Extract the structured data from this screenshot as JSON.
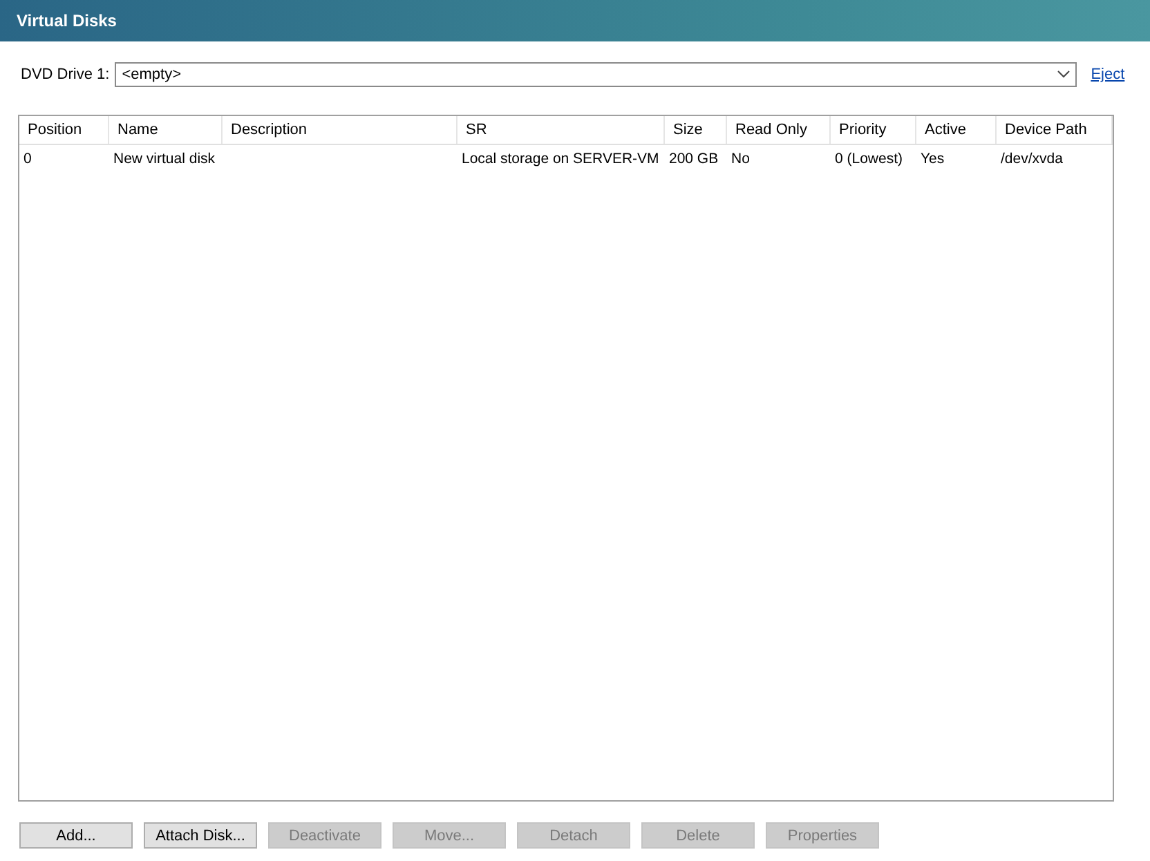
{
  "header": {
    "title": "Virtual Disks"
  },
  "dvd": {
    "label": "DVD Drive 1:",
    "value": "<empty>",
    "link": "Eject"
  },
  "table": {
    "columns": [
      "Position",
      "Name",
      "Description",
      "SR",
      "Size",
      "Read Only",
      "Priority",
      "Active",
      "Device Path"
    ],
    "rows": [
      {
        "selected": false,
        "cells": [
          "0",
          "New virtual disk",
          "",
          "Local storage on SERVER-VM",
          "200 GB",
          "No",
          "0 (Lowest)",
          "Yes",
          "/dev/xvda"
        ]
      }
    ]
  },
  "buttons": [
    {
      "label": "Add...",
      "disabled": false
    },
    {
      "label": "Attach Disk...",
      "disabled": false
    },
    {
      "label": "Deactivate",
      "disabled": true
    },
    {
      "label": "Move...",
      "disabled": true
    },
    {
      "label": "Detach",
      "disabled": true
    },
    {
      "label": "Delete",
      "disabled": true
    },
    {
      "label": "Properties",
      "disabled": true
    }
  ]
}
